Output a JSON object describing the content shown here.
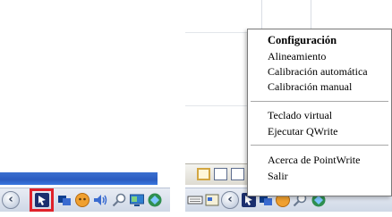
{
  "left_tray": {
    "icons": [
      {
        "name": "chevron-left-icon",
        "glyph": "‹"
      },
      {
        "name": "pointwrite-icon",
        "color": "#1b2f6e"
      },
      {
        "name": "network-icon",
        "color": "#0f3f8f"
      },
      {
        "name": "messenger-icon",
        "color": "#f0a030"
      },
      {
        "name": "speaker-icon",
        "color": "#3a6bd0"
      },
      {
        "name": "search-icon",
        "color": "#6a7a90"
      },
      {
        "name": "display-icon",
        "color": "#2f7fd0"
      },
      {
        "name": "antivirus-icon",
        "color": "#2f8f4f"
      }
    ],
    "highlight_color": "#e0222a"
  },
  "context_menu": {
    "sections": [
      {
        "items": [
          {
            "label": "Configuración",
            "default": true
          },
          {
            "label": "Alineamiento"
          },
          {
            "label": "Calibración automática"
          },
          {
            "label": "Calibración manual"
          }
        ]
      },
      {
        "items": [
          {
            "label": "Teclado virtual"
          },
          {
            "label": "Ejecutar QWrite"
          }
        ]
      },
      {
        "items": [
          {
            "label": "Acerca de PointWrite"
          },
          {
            "label": "Salir"
          }
        ]
      }
    ]
  },
  "right_tray": {
    "icons": [
      {
        "name": "keyboard-icon"
      },
      {
        "name": "show-desktop-icon"
      },
      {
        "name": "chevron-left-icon",
        "glyph": "‹"
      },
      {
        "name": "pointwrite-icon"
      },
      {
        "name": "network-icon"
      },
      {
        "name": "messenger-icon"
      },
      {
        "name": "search-icon"
      },
      {
        "name": "antivirus-icon"
      }
    ]
  },
  "colors": {
    "menu_border": "#7a7a7a",
    "taskbar_blue": "#2b5cc0",
    "toolbar_active": "#d2a642"
  }
}
